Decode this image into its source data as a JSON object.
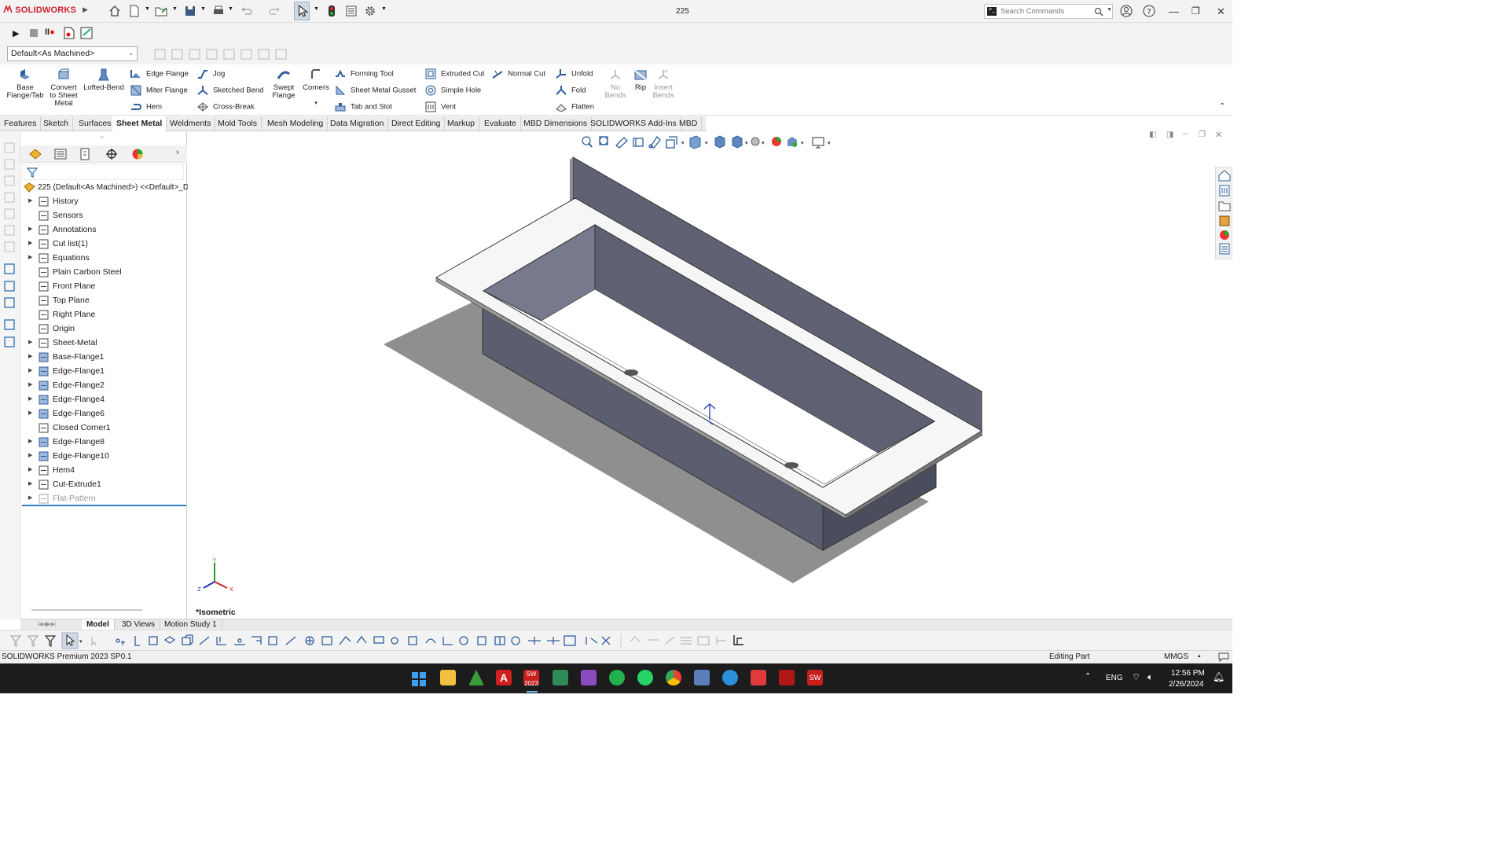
{
  "app": {
    "logo": "SOLIDWORKS",
    "doc_title": "225"
  },
  "search": {
    "placeholder": "Search Commands"
  },
  "config": {
    "selected": "Default<As Machined>"
  },
  "ribbon": {
    "base_flange": "Base Flange/Tab",
    "convert": "Convert to Sheet Metal",
    "lofted_bend": "Lofted-Bend",
    "edge_flange": "Edge Flange",
    "miter_flange": "Miter Flange",
    "hem": "Hem",
    "jog": "Jog",
    "sketched_bend": "Sketched Bend",
    "cross_break": "Cross-Break",
    "swept_flange": "Swept Flange",
    "corners": "Corners",
    "forming_tool": "Forming Tool",
    "sheet_metal_gusset": "Sheet Metal Gusset",
    "tab_and_slot": "Tab and Slot",
    "extruded_cut": "Extruded Cut",
    "simple_hole": "Simple Hole",
    "vent": "Vent",
    "normal_cut": "Normal Cut",
    "unfold": "Unfold",
    "fold": "Fold",
    "flatten": "Flatten",
    "no_bends": "No Bends",
    "rip": "Rip",
    "insert_bends": "Insert Bends"
  },
  "tabs": [
    "Features",
    "Sketch",
    "Surfaces",
    "Sheet Metal",
    "Weldments",
    "Mold Tools",
    "Mesh Modeling",
    "Data Migration",
    "Direct Editing",
    "Markup",
    "Evaluate",
    "MBD Dimensions",
    "SOLIDWORKS Add-Ins",
    "MBD"
  ],
  "active_tab": "Sheet Metal",
  "tree": {
    "root": "225 (Default<As Machined>) <<Default>_D",
    "items": [
      {
        "label": "History",
        "icon": "history-icon",
        "expandable": true
      },
      {
        "label": "Sensors",
        "icon": "sensors-icon",
        "expandable": false
      },
      {
        "label": "Annotations",
        "icon": "annotations-icon",
        "expandable": true
      },
      {
        "label": "Cut list(1)",
        "icon": "cut-list-icon",
        "expandable": true
      },
      {
        "label": "Equations",
        "icon": "equations-icon",
        "expandable": true
      },
      {
        "label": "Plain Carbon Steel",
        "icon": "material-icon",
        "expandable": false
      },
      {
        "label": "Front Plane",
        "icon": "plane-icon",
        "expandable": false
      },
      {
        "label": "Top Plane",
        "icon": "plane-icon",
        "expandable": false
      },
      {
        "label": "Right Plane",
        "icon": "plane-icon",
        "expandable": false
      },
      {
        "label": "Origin",
        "icon": "origin-icon",
        "expandable": false
      },
      {
        "label": "Sheet-Metal",
        "icon": "sheet-metal-icon",
        "expandable": true
      },
      {
        "label": "Base-Flange1",
        "icon": "base-flange-icon",
        "expandable": true
      },
      {
        "label": "Edge-Flange1",
        "icon": "edge-flange-icon",
        "expandable": true
      },
      {
        "label": "Edge-Flange2",
        "icon": "edge-flange-icon",
        "expandable": true
      },
      {
        "label": "Edge-Flange4",
        "icon": "edge-flange-icon",
        "expandable": true
      },
      {
        "label": "Edge-Flange6",
        "icon": "edge-flange-icon",
        "expandable": true
      },
      {
        "label": "Closed Corner1",
        "icon": "closed-corner-icon",
        "expandable": false
      },
      {
        "label": "Edge-Flange8",
        "icon": "edge-flange-icon",
        "expandable": true
      },
      {
        "label": "Edge-Flange10",
        "icon": "edge-flange-icon",
        "expandable": true
      },
      {
        "label": "Hem4",
        "icon": "hem-icon",
        "expandable": true
      },
      {
        "label": "Cut-Extrude1",
        "icon": "cut-extrude-icon",
        "expandable": true
      },
      {
        "label": "Flat-Pattern",
        "icon": "flat-pattern-icon",
        "expandable": true,
        "suppressed": true
      }
    ]
  },
  "viewport": {
    "view_label": "*Isometric",
    "triad": {
      "x": "X",
      "y": "Y",
      "z": "Z"
    }
  },
  "bottom_tabs": [
    "Model",
    "3D Views",
    "Motion Study 1"
  ],
  "active_bottom_tab": "Model",
  "status": {
    "product": "SOLIDWORKS Premium 2023 SP0.1",
    "mode": "Editing Part",
    "units": "MMGS"
  },
  "taskbar": {
    "lang": "ENG",
    "time": "12:56 PM",
    "date": "2/26/2024",
    "sw_version": "2023"
  },
  "colors": {
    "brand": "#d0202e",
    "active_tab": "#ffffff",
    "part_dark": "#5d6070",
    "part_light": "#f7f7f7",
    "taskbar": "#1c1c1c",
    "selection_line": "#2f7fd1"
  }
}
